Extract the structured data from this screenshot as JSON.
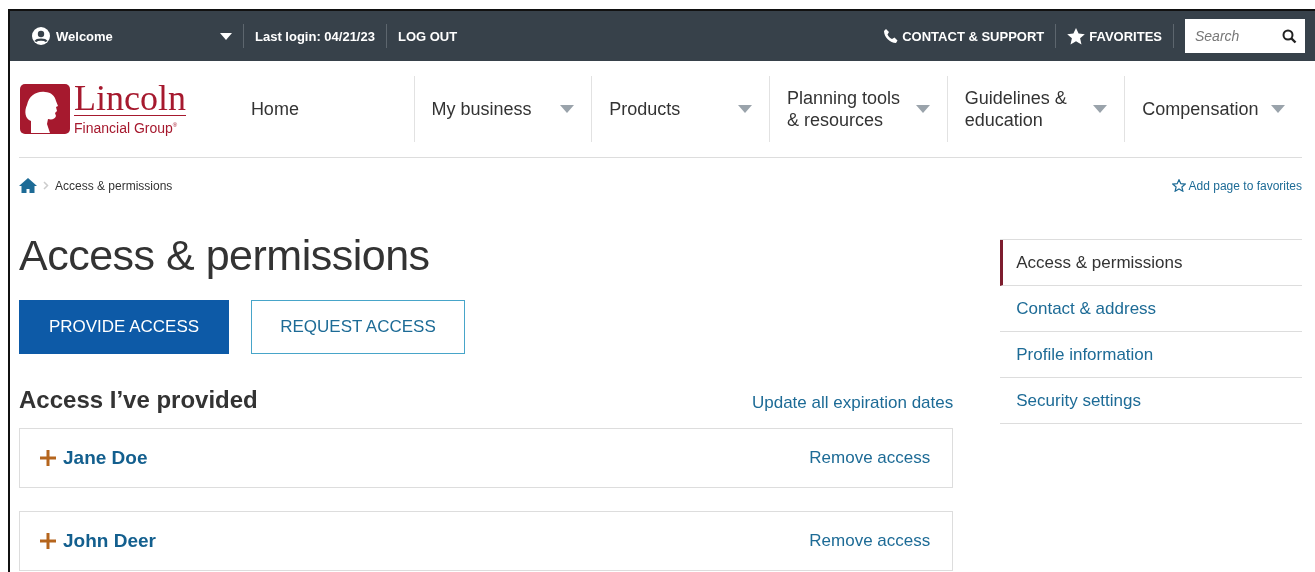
{
  "top_bar": {
    "welcome": "Welcome",
    "last_login": "Last login: 04/21/23",
    "logout": "LOG OUT",
    "contact": "CONTACT & SUPPORT",
    "favorites": "FAVORITES",
    "search": {
      "placeholder": "Search"
    }
  },
  "logo": {
    "name": "Lincoln",
    "subtitle": "Financial Group$^{®}$"
  },
  "nav": [
    {
      "label": "Home",
      "dropdown": false
    },
    {
      "label": "My business",
      "dropdown": true
    },
    {
      "label": "Products",
      "dropdown": true
    },
    {
      "label": "Planning tools & resources",
      "dropdown": true
    },
    {
      "label": "Guidelines & education",
      "dropdown": true
    },
    {
      "label": "Compensation",
      "dropdown": true
    }
  ],
  "breadcrumb": [
    "Access & permissions"
  ],
  "add_favorite": "Add page to favorites",
  "title": "Access & permissions",
  "actions": [
    {
      "label": "PROVIDE ACCESS",
      "kind": "primary"
    },
    {
      "label": "REQUEST ACCESS",
      "kind": "secondary"
    }
  ],
  "section": {
    "heading": "Access I’ve provided",
    "link": "Update all expiration dates"
  },
  "people": [
    {
      "name": "Jane Doe",
      "expanded": false,
      "action": "Remove access"
    },
    {
      "name": "John Deer",
      "expanded": false,
      "action": "Remove access"
    }
  ],
  "side_nav": [
    {
      "label": "Access & permissions",
      "selected": true
    },
    {
      "label": "Contact & address",
      "selected": false
    },
    {
      "label": "Profile information",
      "selected": false
    },
    {
      "label": "Security settings",
      "selected": false
    }
  ]
}
